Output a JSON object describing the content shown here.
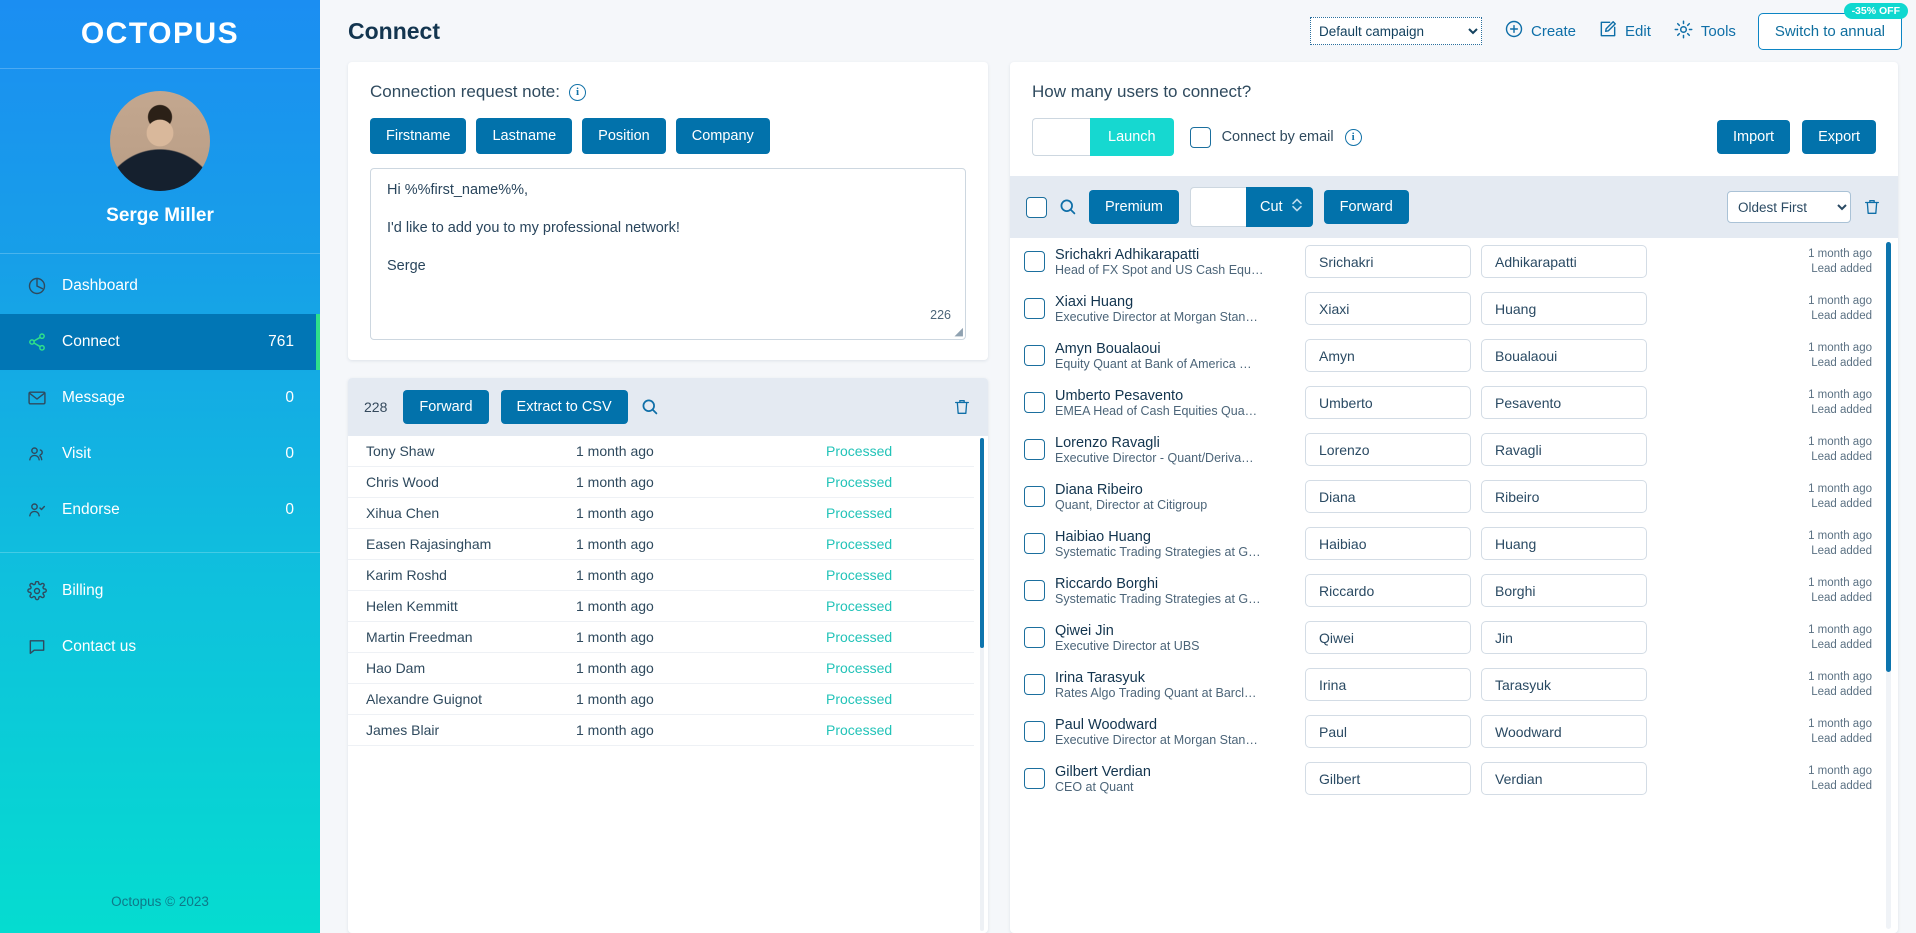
{
  "sidebar": {
    "brand": "OCTOPUS",
    "profile_name": "Serge Miller",
    "items": [
      {
        "label": "Dashboard",
        "count": "",
        "icon": "dashboard-icon",
        "active": false
      },
      {
        "label": "Connect",
        "count": "761",
        "icon": "share-icon",
        "active": true
      },
      {
        "label": "Message",
        "count": "0",
        "icon": "envelope-icon",
        "active": false
      },
      {
        "label": "Visit",
        "count": "0",
        "icon": "users-icon",
        "active": false
      },
      {
        "label": "Endorse",
        "count": "0",
        "icon": "user-check-icon",
        "active": false
      }
    ],
    "secondary_items": [
      {
        "label": "Billing",
        "icon": "gear-icon"
      },
      {
        "label": "Contact us",
        "icon": "chat-icon"
      }
    ],
    "footer": "Octopus © 2023"
  },
  "topbar": {
    "page_title": "Connect",
    "campaign_selected": "Default campaign",
    "campaign_options": [
      "Default campaign"
    ],
    "create_label": "Create",
    "edit_label": "Edit",
    "tools_label": "Tools",
    "switch_label": "Switch to annual",
    "discount_badge": "-35% OFF"
  },
  "note_card": {
    "title": "Connection request note:",
    "tokens": [
      "Firstname",
      "Lastname",
      "Position",
      "Company"
    ],
    "body_lines": [
      "Hi %%first_name%%,",
      "I'd like to add you to my professional network!",
      "Serge"
    ],
    "char_count": "226"
  },
  "processed_panel": {
    "count": "228",
    "forward_label": "Forward",
    "extract_label": "Extract to CSV",
    "rows": [
      {
        "name": "Tony Shaw",
        "time": "1 month ago",
        "status": "Processed"
      },
      {
        "name": "Chris Wood",
        "time": "1 month ago",
        "status": "Processed"
      },
      {
        "name": "Xihua Chen",
        "time": "1 month ago",
        "status": "Processed"
      },
      {
        "name": "Easen Rajasingham",
        "time": "1 month ago",
        "status": "Processed"
      },
      {
        "name": "Karim Roshd",
        "time": "1 month ago",
        "status": "Processed"
      },
      {
        "name": "Helen Kemmitt",
        "time": "1 month ago",
        "status": "Processed"
      },
      {
        "name": "Martin Freedman",
        "time": "1 month ago",
        "status": "Processed"
      },
      {
        "name": "Hao Dam",
        "time": "1 month ago",
        "status": "Processed"
      },
      {
        "name": "Alexandre Guignot",
        "time": "1 month ago",
        "status": "Processed"
      },
      {
        "name": "James Blair",
        "time": "1 month ago",
        "status": "Processed"
      }
    ]
  },
  "right_panel": {
    "question": "How many users to connect?",
    "launch_value": "",
    "launch_label": "Launch",
    "connect_by_email_label": "Connect by email",
    "import_label": "Import",
    "export_label": "Export",
    "premium_label": "Premium",
    "cut_value": "",
    "cut_label": "Cut",
    "forward_label": "Forward",
    "sort_selected": "Oldest First",
    "sort_options": [
      "Oldest First"
    ],
    "leads": [
      {
        "name": "Srichakri Adhikarapatti",
        "title": "Head of FX Spot and US Cash Equ…",
        "first": "Srichakri",
        "last": "Adhikarapatti",
        "time": "1 month ago",
        "event": "Lead added"
      },
      {
        "name": "Xiaxi Huang",
        "title": "Executive Director at Morgan Stan…",
        "first": "Xiaxi",
        "last": "Huang",
        "time": "1 month ago",
        "event": "Lead added"
      },
      {
        "name": "Amyn Boualaoui",
        "title": "Equity Quant at Bank of America …",
        "first": "Amyn",
        "last": "Boualaoui",
        "time": "1 month ago",
        "event": "Lead added"
      },
      {
        "name": "Umberto Pesavento",
        "title": "EMEA Head of Cash Equities Qua…",
        "first": "Umberto",
        "last": "Pesavento",
        "time": "1 month ago",
        "event": "Lead added"
      },
      {
        "name": "Lorenzo Ravagli",
        "title": "Executive Director - Quant/Deriva…",
        "first": "Lorenzo",
        "last": "Ravagli",
        "time": "1 month ago",
        "event": "Lead added"
      },
      {
        "name": "Diana Ribeiro",
        "title": "Quant, Director at Citigroup",
        "first": "Diana",
        "last": "Ribeiro",
        "time": "1 month ago",
        "event": "Lead added"
      },
      {
        "name": "Haibiao Huang",
        "title": "Systematic Trading Strategies at G…",
        "first": "Haibiao",
        "last": "Huang",
        "time": "1 month ago",
        "event": "Lead added"
      },
      {
        "name": "Riccardo Borghi",
        "title": "Systematic Trading Strategies at G…",
        "first": "Riccardo",
        "last": "Borghi",
        "time": "1 month ago",
        "event": "Lead added"
      },
      {
        "name": "Qiwei Jin",
        "title": "Executive Director at UBS",
        "first": "Qiwei",
        "last": "Jin",
        "time": "1 month ago",
        "event": "Lead added"
      },
      {
        "name": "Irina Tarasyuk",
        "title": "Rates Algo Trading Quant at Barcl…",
        "first": "Irina",
        "last": "Tarasyuk",
        "time": "1 month ago",
        "event": "Lead added"
      },
      {
        "name": "Paul Woodward",
        "title": "Executive Director at Morgan Stan…",
        "first": "Paul",
        "last": "Woodward",
        "time": "1 month ago",
        "event": "Lead added"
      },
      {
        "name": "Gilbert Verdian",
        "title": "CEO at Quant",
        "first": "Gilbert",
        "last": "Verdian",
        "time": "1 month ago",
        "event": "Lead added"
      }
    ]
  },
  "colors": {
    "accent_blue": "#0272ab",
    "teal": "#16d8d0",
    "sidebar_active": "#0176b5",
    "green_accent": "#2fe08a",
    "status_green": "#22c3b8"
  }
}
